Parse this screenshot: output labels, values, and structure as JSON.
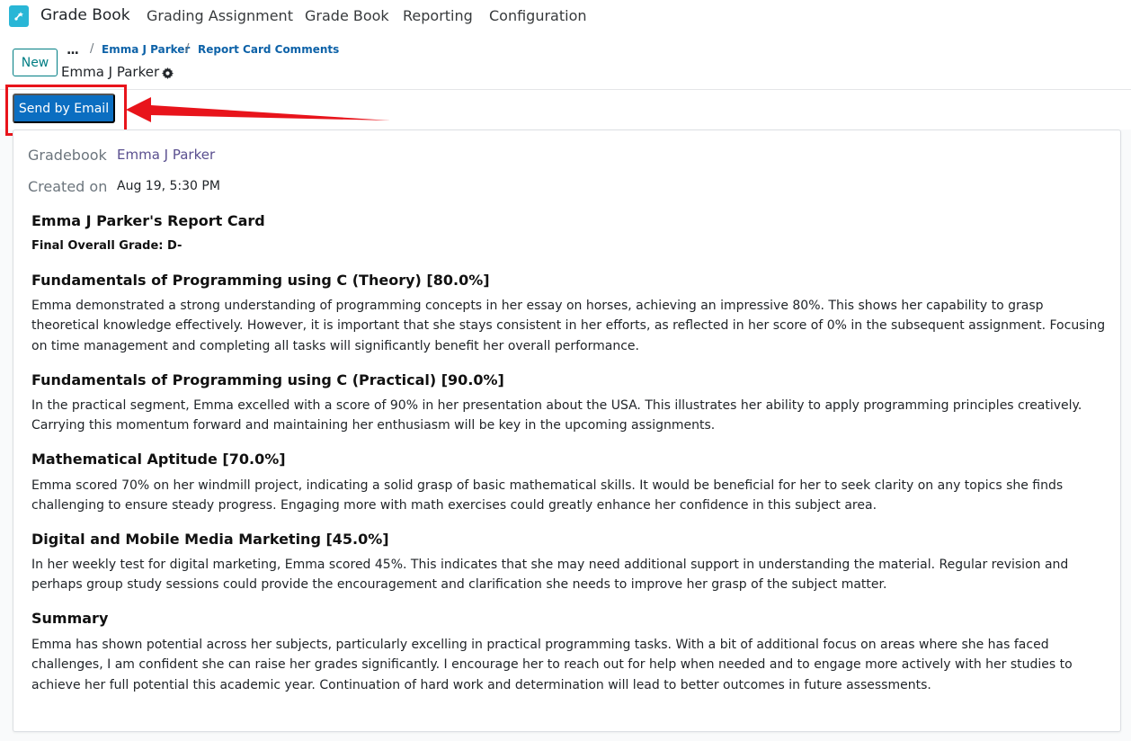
{
  "nav": {
    "app_title": "Grade Book",
    "menu": [
      "Grading Assignment",
      "Grade Book",
      "Reporting",
      "Configuration"
    ]
  },
  "control_panel": {
    "new_label": "New",
    "breadcrumb_more": "...",
    "breadcrumb_sep": "/",
    "breadcrumbs": [
      "Emma J Parker",
      "Report Card Comments"
    ],
    "record_name": "Emma J Parker"
  },
  "actions": {
    "send_email_label": "Send by Email"
  },
  "fields": {
    "gradebook_label": "Gradebook",
    "gradebook_value": "Emma J Parker",
    "created_label": "Created on",
    "created_value": "Aug 19, 5:30 PM"
  },
  "report": {
    "title": "Emma J Parker's Report Card",
    "final_grade": "Final Overall Grade: D-",
    "sections": [
      {
        "title": "Fundamentals of Programming using C (Theory) [80.0%]",
        "body": "Emma demonstrated a strong understanding of programming concepts in her essay on horses, achieving an impressive 80%. This shows her capability to grasp theoretical knowledge effectively. However, it is important that she stays consistent in her efforts, as reflected in her score of 0% in the subsequent assignment. Focusing on time management and completing all tasks will significantly benefit her overall performance."
      },
      {
        "title": "Fundamentals of Programming using C (Practical) [90.0%]",
        "body": "In the practical segment, Emma excelled with a score of 90% in her presentation about the USA. This illustrates her ability to apply programming principles creatively. Carrying this momentum forward and maintaining her enthusiasm will be key in the upcoming assignments."
      },
      {
        "title": "Mathematical Aptitude [70.0%]",
        "body": "Emma scored 70% on her windmill project, indicating a solid grasp of basic mathematical skills. It would be beneficial for her to seek clarity on any topics she finds challenging to ensure steady progress. Engaging more with math exercises could greatly enhance her confidence in this subject area."
      },
      {
        "title": "Digital and Mobile Media Marketing [45.0%]",
        "body": "In her weekly test for digital marketing, Emma scored 45%. This indicates that she may need additional support in understanding the material. Regular revision and perhaps group study sessions could provide the encouragement and clarification she needs to improve her grasp of the subject matter."
      },
      {
        "title": "Summary",
        "body": "Emma has shown potential across her subjects, particularly excelling in practical programming tasks. With a bit of additional focus on areas where she has faced challenges, I am confident she can raise her grades significantly. I encourage her to reach out for help when needed and to engage more actively with her studies to achieve her full potential this academic year. Continuation of hard work and determination will lead to better outcomes in future assessments."
      }
    ]
  },
  "colors": {
    "primary_button": "#0b6ec1",
    "highlight_annotation": "#e8141b",
    "app_icon": "#29b6d6"
  }
}
